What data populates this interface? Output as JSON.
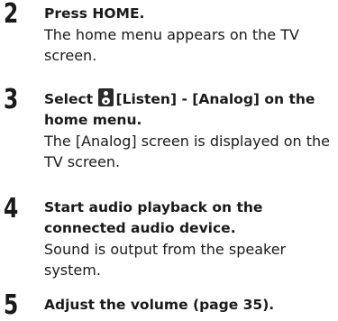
{
  "steps": [
    {
      "number": "2",
      "title": "Press HOME.",
      "description": "The home menu appears on the TV screen."
    },
    {
      "number": "3",
      "title_pre": "Select",
      "title_icon": "speaker-icon",
      "title_post_line1": "[Listen] - [Analog] on the",
      "title_post_line2": "home menu.",
      "description": "The [Analog] screen is displayed on the TV screen."
    },
    {
      "number": "4",
      "title_line1": "Start audio playback on the",
      "title_line2": "connected audio device.",
      "description": "Sound is output from the speaker system."
    },
    {
      "number": "5",
      "title": "Adjust the volume (page 35)."
    }
  ]
}
